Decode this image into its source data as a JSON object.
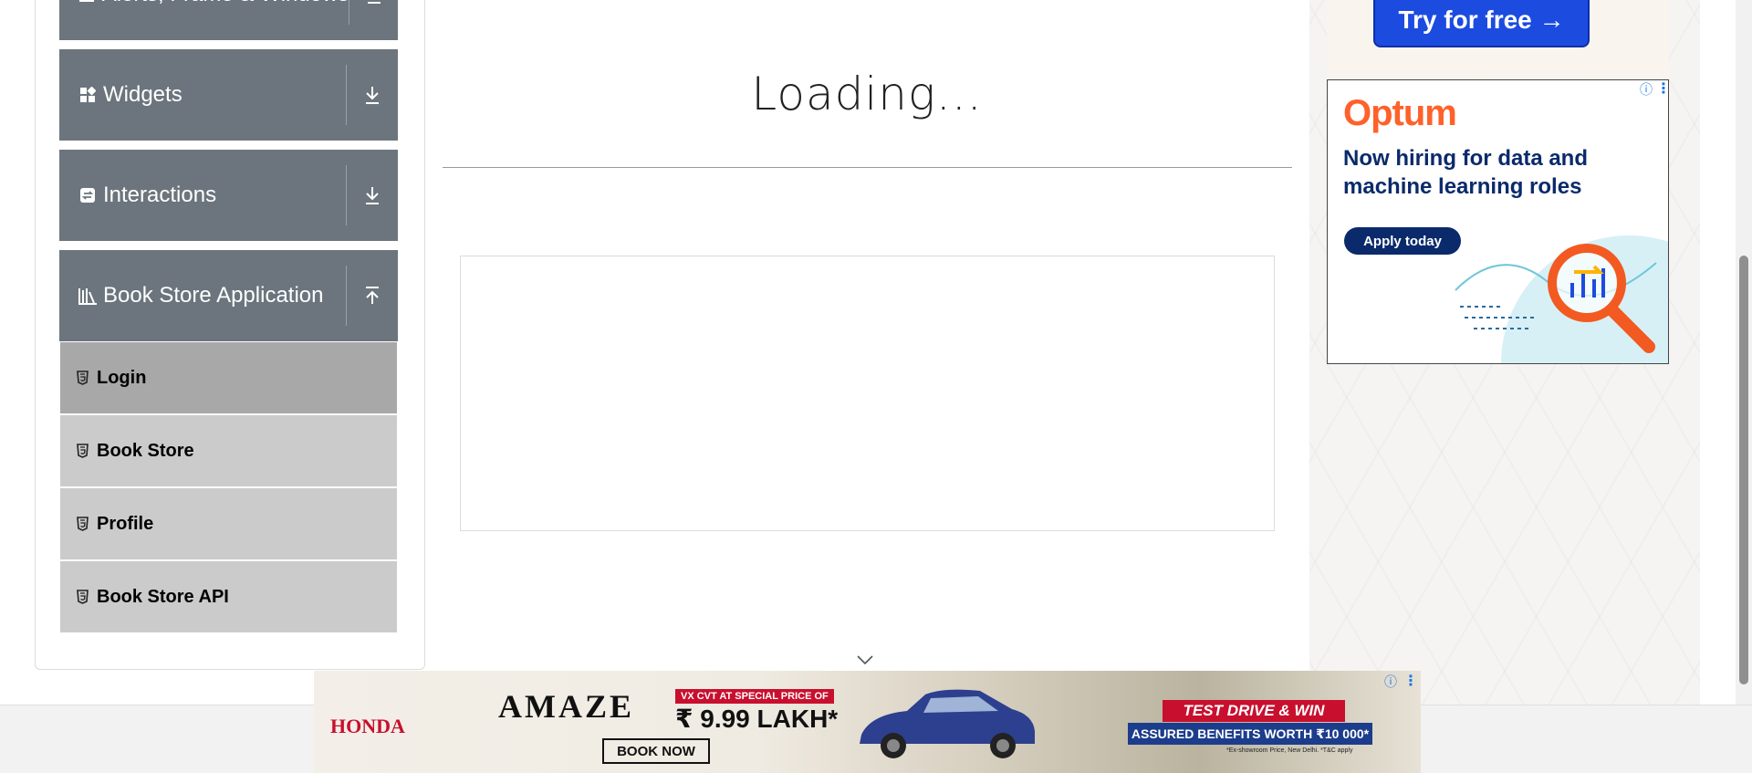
{
  "sidebar": {
    "groups": [
      {
        "title": "Alerts, Frame & Windows",
        "icon": "alerts-icon"
      },
      {
        "title": "Widgets",
        "icon": "widgets-icon"
      },
      {
        "title": "Interactions",
        "icon": "interactions-icon"
      },
      {
        "title": "Book Store Application",
        "icon": "bookstore-icon"
      }
    ],
    "book_store_items": [
      {
        "label": "Login",
        "active": true
      },
      {
        "label": "Book Store",
        "active": false
      },
      {
        "label": "Profile",
        "active": false
      },
      {
        "label": "Book Store API",
        "active": false
      }
    ]
  },
  "main": {
    "loading_text": "Loading..."
  },
  "ads": {
    "top_button": "Try for free →",
    "optum": {
      "logo": "Optum",
      "headline": "Now hiring for data and machine learning roles",
      "button": "Apply today"
    },
    "honda": {
      "brand": "HONDA",
      "model": "AMAZE",
      "special": "VX CVT AT SPECIAL PRICE OF",
      "price": "₹ 9.99 LAKH*",
      "cta": "BOOK NOW",
      "test_drive": "TEST DRIVE & WIN",
      "benefits": "ASSURED BENEFITS WORTH ₹10 000*",
      "fine_print": "*Ex-showroom Price, New Delhi. *T&C apply"
    },
    "info_glyph": "ⓘ",
    "menu_glyph": "⋮"
  },
  "colors": {
    "group_bg": "#6c757d",
    "item_bg": "#cbcbcb",
    "item_active_bg": "#a8a8a8",
    "try_button": "#1c4be0",
    "optum_orange": "#ff612b",
    "optum_navy": "#0a2a6b"
  }
}
